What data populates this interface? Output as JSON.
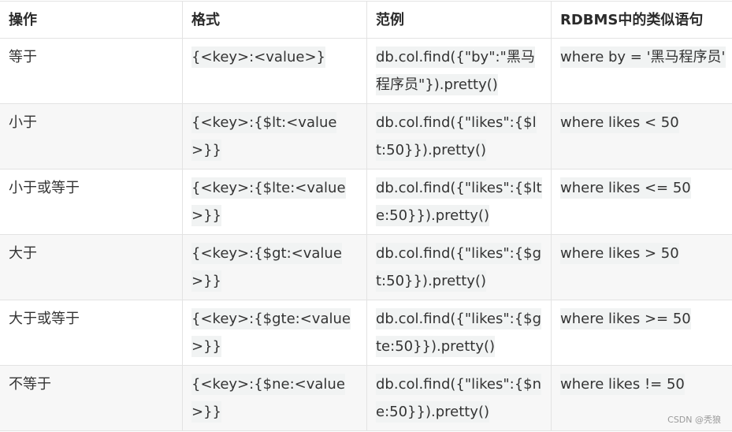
{
  "table": {
    "headers": [
      "操作",
      "格式",
      "范例",
      "RDBMS中的类似语句"
    ],
    "rows": [
      {
        "operation": "等于",
        "format": "{<key>:<value>}",
        "example": "db.col.find({\"by\":\"黑马程序员\"}).pretty()",
        "rdbms": "where by = '黑马程序员'"
      },
      {
        "operation": "小于",
        "format": "{<key>:{$lt:<value>}}",
        "example": "db.col.find({\"likes\":{$lt:50}}).pretty()",
        "rdbms": "where likes < 50"
      },
      {
        "operation": "小于或等于",
        "format": "{<key>:{$lte:<value>}}",
        "example": "db.col.find({\"likes\":{$lte:50}}).pretty()",
        "rdbms": "where likes <= 50"
      },
      {
        "operation": "大于",
        "format": "{<key>:{$gt:<value>}}",
        "example": "db.col.find({\"likes\":{$gt:50}}).pretty()",
        "rdbms": "where likes > 50"
      },
      {
        "operation": "大于或等于",
        "format": "{<key>:{$gte:<value>}}",
        "example": "db.col.find({\"likes\":{$gte:50}}).pretty()",
        "rdbms": "where likes >= 50"
      },
      {
        "operation": "不等于",
        "format": "{<key>:{$ne:<value>}}",
        "example": "db.col.find({\"likes\":{$ne:50}}).pretty()",
        "rdbms": "where likes != 50"
      }
    ]
  },
  "watermark": "CSDN @秃狼"
}
